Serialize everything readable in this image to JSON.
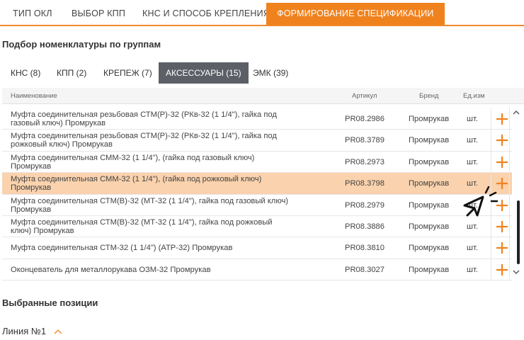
{
  "top_tabs": [
    {
      "label": "ТИП ОКЛ"
    },
    {
      "label": "ВЫБОР КПП"
    },
    {
      "label": "КНС И СПОСОБ КРЕПЛЕНИЯ"
    },
    {
      "label": "ФОРМИРОВАНИЕ СПЕЦИФИКАЦИИ",
      "active": true
    }
  ],
  "section_title": "Подбор номенклатуры по группам",
  "group_tabs": [
    {
      "label": "КНС (8)"
    },
    {
      "label": "КПП (2)"
    },
    {
      "label": "КРЕПЕЖ (7)"
    },
    {
      "label": "АКСЕССУАРЫ (15)",
      "active": true
    },
    {
      "label": "ЭМК (39)"
    }
  ],
  "table": {
    "headers": {
      "name": "Наименование",
      "article": "Артикул",
      "brand": "Бренд",
      "unit": "Ед.изм"
    },
    "rows": [
      {
        "name": "Муфта соединительная резьбовая СТМ(Р)-32 (РКв-32 (1 1/4\"), гайка под газовый ключ) Промрукав",
        "article": "PR08.2986",
        "brand": "Промрукав",
        "unit": "шт."
      },
      {
        "name": "Муфта соединительная резьбовая СТМ(Р)-32 (РКв-32 (1 1/4\"), гайка под рожковый ключ) Промрукав",
        "article": "PR08.3789",
        "brand": "Промрукав",
        "unit": "шт."
      },
      {
        "name": "Муфта соединительная СММ-32 (1 1/4\"), (гайка под газовый ключ) Промрукав",
        "article": "PR08.2973",
        "brand": "Промрукав",
        "unit": "шт."
      },
      {
        "name": "Муфта соединительная СММ-32 (1 1/4\"), (гайка под рожковый ключ) Промрукав",
        "article": "PR08.3798",
        "brand": "Промрукав",
        "unit": "шт.",
        "selected": true
      },
      {
        "name": "Муфта соединительная СТМ(В)-32 (МТ-32 (1 1/4\"), гайка под газовый ключ) Промрукав",
        "article": "PR08.2979",
        "brand": "Промрукав",
        "unit": "шт."
      },
      {
        "name": "Муфта соединительная СТМ(В)-32 (МТ-32 (1 1/4\"), гайка под рожковый ключ) Промрукав",
        "article": "PR08.3886",
        "brand": "Промрукав",
        "unit": "шт."
      },
      {
        "name": "Муфта соединительная СТМ-32 (1 1/4\") (АТР-32) Промрукав",
        "article": "PR08.3810",
        "brand": "Промрукав",
        "unit": "шт."
      },
      {
        "name": "Оконцеватель для металлорукава ОЗМ-32 Промрукав",
        "article": "PR08.3027",
        "brand": "Промрукав",
        "unit": "шт."
      }
    ]
  },
  "selected_title": "Выбранные позиции",
  "line_label": "Линия №1",
  "icons": {
    "add": "plus-icon",
    "cursor": "click-cursor-icon",
    "expand": "chevron-up-icon"
  },
  "colors": {
    "accent": "#f0821e",
    "selected_row": "#fad2ad",
    "active_group_tab": "#5c6066"
  }
}
